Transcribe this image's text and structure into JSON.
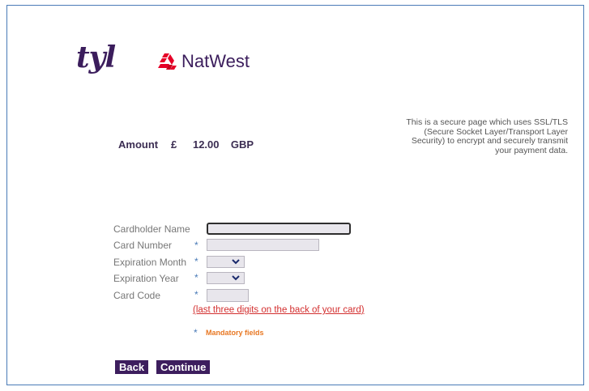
{
  "brand": {
    "tyl": "tyl",
    "natwest": "NatWest",
    "natwest_color": "#e60028",
    "purple": "#3b1d5c"
  },
  "secure_note": "This is a secure page which uses SSL/TLS (Secure Socket Layer/Transport Layer Security) to encrypt and securely transmit your payment data.",
  "amount": {
    "label": "Amount",
    "currency_symbol": "£",
    "value": "12.00",
    "currency_code": "GBP"
  },
  "form": {
    "cardholder_name": {
      "label": "Cardholder Name",
      "value": ""
    },
    "card_number": {
      "label": "Card Number",
      "required": "*",
      "value": ""
    },
    "expiration_month": {
      "label": "Expiration Month",
      "required": "*",
      "value": ""
    },
    "expiration_year": {
      "label": "Expiration Year",
      "required": "*",
      "value": ""
    },
    "card_code": {
      "label": "Card Code",
      "required": "*",
      "value": ""
    },
    "card_code_hint": "(last three digits on the back of your card)"
  },
  "mandatory": {
    "star": "*",
    "text": "Mandatory fields"
  },
  "buttons": {
    "back": "Back",
    "continue": "Continue"
  },
  "icons": {
    "natwest_logo": "natwest-cube-icon",
    "dropdown": "chevron-down-icon"
  }
}
